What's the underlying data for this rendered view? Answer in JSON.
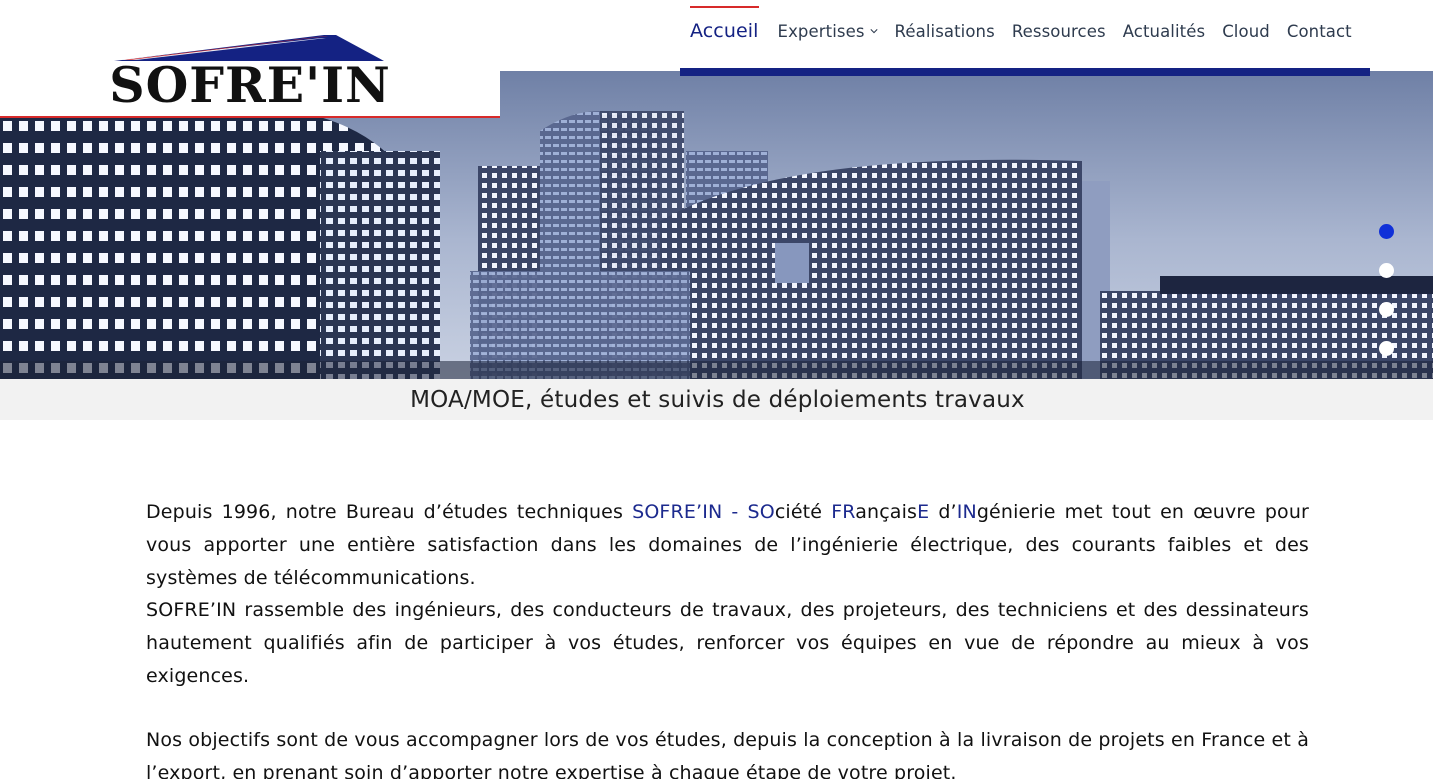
{
  "brand": {
    "name": "SOFRE'IN",
    "colors": {
      "primary": "#142283",
      "accent": "#d72a2a",
      "active_dot": "#1030d8"
    }
  },
  "nav": {
    "items": [
      {
        "label": "Accueil",
        "active": true
      },
      {
        "label": "Expertises",
        "has_dropdown": true
      },
      {
        "label": "Réalisations"
      },
      {
        "label": "Ressources"
      },
      {
        "label": "Actualités"
      },
      {
        "label": "Cloud"
      },
      {
        "label": "Contact"
      }
    ]
  },
  "hero": {
    "caption": "MOA/MOE, études et suivis de déploiements travaux",
    "slides_count": 4,
    "active_slide": 1
  },
  "intro": {
    "p1_a": "Depuis 1996, notre Bureau d’études techniques ",
    "p1_hl1": "SOFRE’IN - SO",
    "p1_b": "ciété ",
    "p1_hl2": "FR",
    "p1_c": "ançais",
    "p1_hl3": "E",
    "p1_d": " d’",
    "p1_hl4": "IN",
    "p1_e": "génierie met tout en œuvre pour vous apporter une entière satisfaction dans les domaines de l’ingénierie électrique, des courants faibles et des systèmes de télécommunications.",
    "p2": "SOFRE’IN rassemble des ingénieurs, des conducteurs de travaux, des projeteurs, des techniciens et des dessinateurs hautement qualifiés afin de participer à vos études, renforcer vos équipes en vue de répondre au mieux à vos exigences.",
    "p3": "Nos objectifs sont de vous accompagner lors de vos études, depuis la conception à la livraison de projets en France et à l’export, en prenant soin d’apporter notre expertise à chaque étape de votre projet."
  }
}
